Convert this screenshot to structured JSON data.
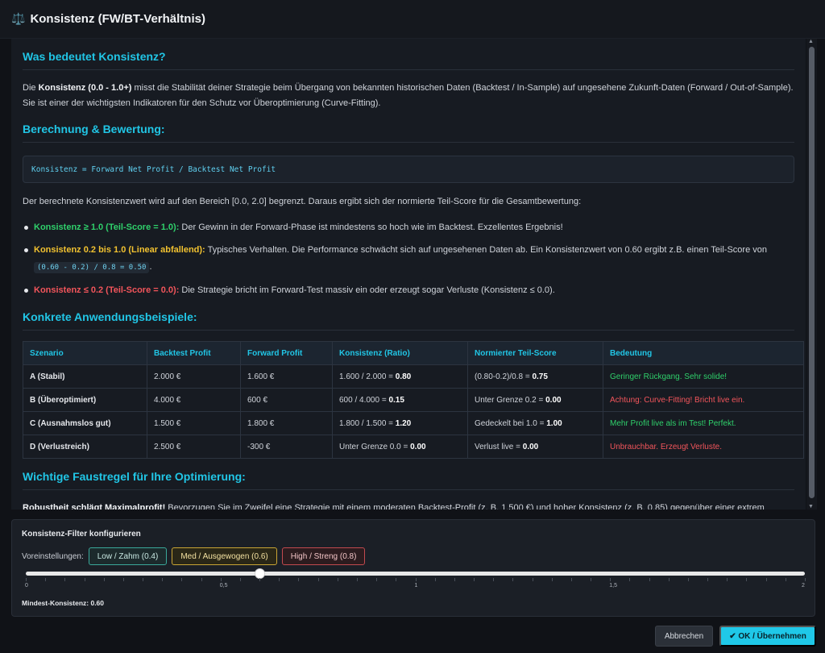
{
  "window": {
    "icon": "scales-icon",
    "icon_glyph": "⚖️",
    "title": "Konsistenz (FW/BT-Verhältnis)"
  },
  "section1": {
    "heading": "Was bedeutet Konsistenz?",
    "p_pre": "Die ",
    "p_bold": "Konsistenz (0.0 - 1.0+)",
    "p_rest": " misst die Stabilität deiner Strategie beim Übergang von bekannten historischen Daten (Backtest / In-Sample) auf ungesehene Zukunft-Daten (Forward / Out-of-Sample). Sie ist einer der wichtigsten Indikatoren für den Schutz vor Überoptimierung (Curve-Fitting)."
  },
  "section2": {
    "heading": "Berechnung & Bewertung:",
    "formula": "Konsistenz = Forward Net Profit / Backtest Net Profit",
    "intro": "Der berechnete Konsistenzwert wird auf den Bereich [0.0, 2.0] begrenzt. Daraus ergibt sich der normierte Teil-Score für die Gesamtbewertung:",
    "bullets": [
      {
        "label": "Konsistenz ≥ 1.0 (Teil-Score = 1.0):",
        "text": " Der Gewinn in der Forward-Phase ist mindestens so hoch wie im Backtest. Exzellentes Ergebnis!"
      },
      {
        "label": "Konsistenz 0.2 bis 1.0 (Linear abfallend):",
        "text": " Typisches Verhalten. Die Performance schwächt sich auf ungesehenen Daten ab. Ein Konsistenzwert von 0.60 ergibt z.B. einen Teil-Score von ",
        "code": "(0.60 - 0.2) / 0.8 = 0.50",
        "tail": "."
      },
      {
        "label": "Konsistenz ≤ 0.2 (Teil-Score = 0.0):",
        "text": " Die Strategie bricht im Forward-Test massiv ein oder erzeugt sogar Verluste (Konsistenz ≤ 0.0)."
      }
    ]
  },
  "section3": {
    "heading": "Konkrete Anwendungsbeispiele:",
    "headers": [
      "Szenario",
      "Backtest Profit",
      "Forward Profit",
      "Konsistenz (Ratio)",
      "Normierter Teil-Score",
      "Bedeutung"
    ],
    "rows": [
      {
        "szenario": "A (Stabil)",
        "bt": "2.000 €",
        "fw": "1.600 €",
        "k_pre": "1.600 / 2.000 = ",
        "k_val": "0.80",
        "s_pre": "(0.80-0.2)/0.8 = ",
        "s_val": "0.75",
        "bedeutung": "Geringer Rückgang. Sehr solide!",
        "status": "ok"
      },
      {
        "szenario": "B (Überoptimiert)",
        "bt": "4.000 €",
        "fw": "600 €",
        "k_pre": "600 / 4.000 = ",
        "k_val": "0.15",
        "s_pre": "Unter Grenze 0.2 = ",
        "s_val": "0.00",
        "bedeutung": "Achtung: Curve-Fitting! Bricht live ein.",
        "status": "bad"
      },
      {
        "szenario": "C (Ausnahmslos gut)",
        "bt": "1.500 €",
        "fw": "1.800 €",
        "k_pre": "1.800 / 1.500 = ",
        "k_val": "1.20",
        "s_pre": "Gedeckelt bei 1.0 = ",
        "s_val": "1.00",
        "bedeutung": "Mehr Profit live als im Test! Perfekt.",
        "status": "ok"
      },
      {
        "szenario": "D (Verlustreich)",
        "bt": "2.500 €",
        "fw": "-300 €",
        "k_pre": "Unter Grenze 0.0 = ",
        "k_val": "0.00",
        "s_pre": "Verlust live = ",
        "s_val": "0.00",
        "bedeutung": "Unbrauchbar. Erzeugt Verluste.",
        "status": "bad"
      }
    ]
  },
  "section4": {
    "heading": "Wichtige Faustregel für Ihre Optimierung:",
    "p_bold": "Robustheit schlägt Maximalprofit!",
    "p_rest": " Bevorzugen Sie im Zweifel eine Strategie mit einem moderaten Backtest-Profit (z. B. 1.500 €) und hoher Konsistenz (z. B. 0.85) gegenüber einer extrem"
  },
  "filter": {
    "title": "Konsistenz-Filter konfigurieren",
    "presets_label": "Voreinstellungen:",
    "presets": {
      "low": "Low / Zahm (0.4)",
      "med": "Med / Ausgewogen (0.6)",
      "high": "High / Streng (0.8)"
    },
    "slider": {
      "min": 0,
      "max": 2,
      "value": 0.6,
      "labels": [
        "0",
        "0,5",
        "1",
        "1,5",
        "2"
      ]
    },
    "min_label": "Mindest-Konsistenz: 0.60"
  },
  "buttons": {
    "cancel": "Abbrechen",
    "ok": "✔ OK / Übernehmen"
  }
}
